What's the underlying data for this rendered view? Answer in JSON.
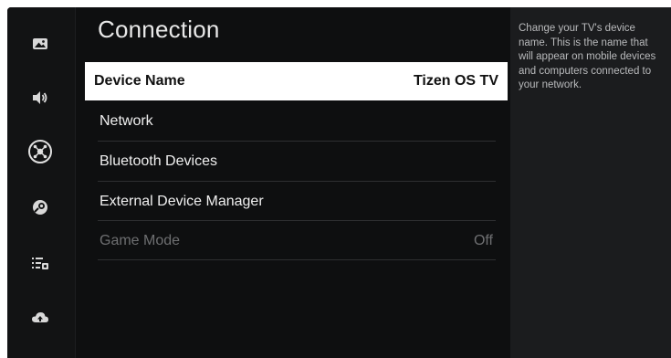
{
  "sidebar": {
    "icons": [
      {
        "name": "picture-icon"
      },
      {
        "name": "sound-icon"
      },
      {
        "name": "connection-icon"
      },
      {
        "name": "support-icon"
      },
      {
        "name": "general-icon"
      },
      {
        "name": "cloud-icon"
      }
    ]
  },
  "main": {
    "title": "Connection",
    "items": [
      {
        "label": "Device Name",
        "value": "Tizen OS TV",
        "selected": true
      },
      {
        "label": "Network",
        "value": ""
      },
      {
        "label": "Bluetooth Devices",
        "value": ""
      },
      {
        "label": "External Device Manager",
        "value": ""
      },
      {
        "label": "Game Mode",
        "value": "Off",
        "disabled": true
      }
    ]
  },
  "help": {
    "text": "Change your TV's device name. This is the name that will appear on mobile devices and computers connected to your network."
  },
  "colors": {
    "background": "#0e0f10",
    "selected_bg": "#ffffff",
    "help_bg": "#1b1c1e"
  }
}
